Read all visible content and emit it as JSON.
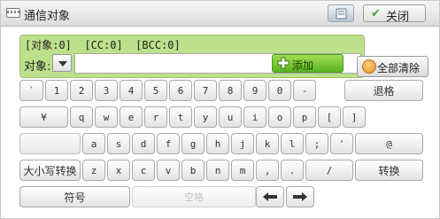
{
  "window": {
    "title": "通信对象",
    "close_label": "关闭"
  },
  "recipients": {
    "counts": "[对象:0]  [CC:0]  [BCC:0]",
    "field_label": "对象:",
    "input_value": "",
    "add_label": "添加"
  },
  "clear_all_label": "全部清除",
  "keyboard": {
    "row1": [
      "`",
      "1",
      "2",
      "3",
      "4",
      "5",
      "6",
      "7",
      "8",
      "9",
      "0",
      "-"
    ],
    "backspace_label": "退格",
    "row2": [
      "¥",
      "q",
      "w",
      "e",
      "r",
      "t",
      "y",
      "u",
      "i",
      "o",
      "p",
      "[",
      "]"
    ],
    "row3": [
      "a",
      "s",
      "d",
      "f",
      "g",
      "h",
      "j",
      "k",
      "l",
      ";",
      "'",
      "@"
    ],
    "caps_label": "大小写转换",
    "row4": [
      "z",
      "x",
      "c",
      "v",
      "b",
      "n",
      "m",
      ",",
      ".",
      "/"
    ],
    "convert_label": "转换",
    "symbol_label": "符号",
    "space_label": "空格"
  }
}
